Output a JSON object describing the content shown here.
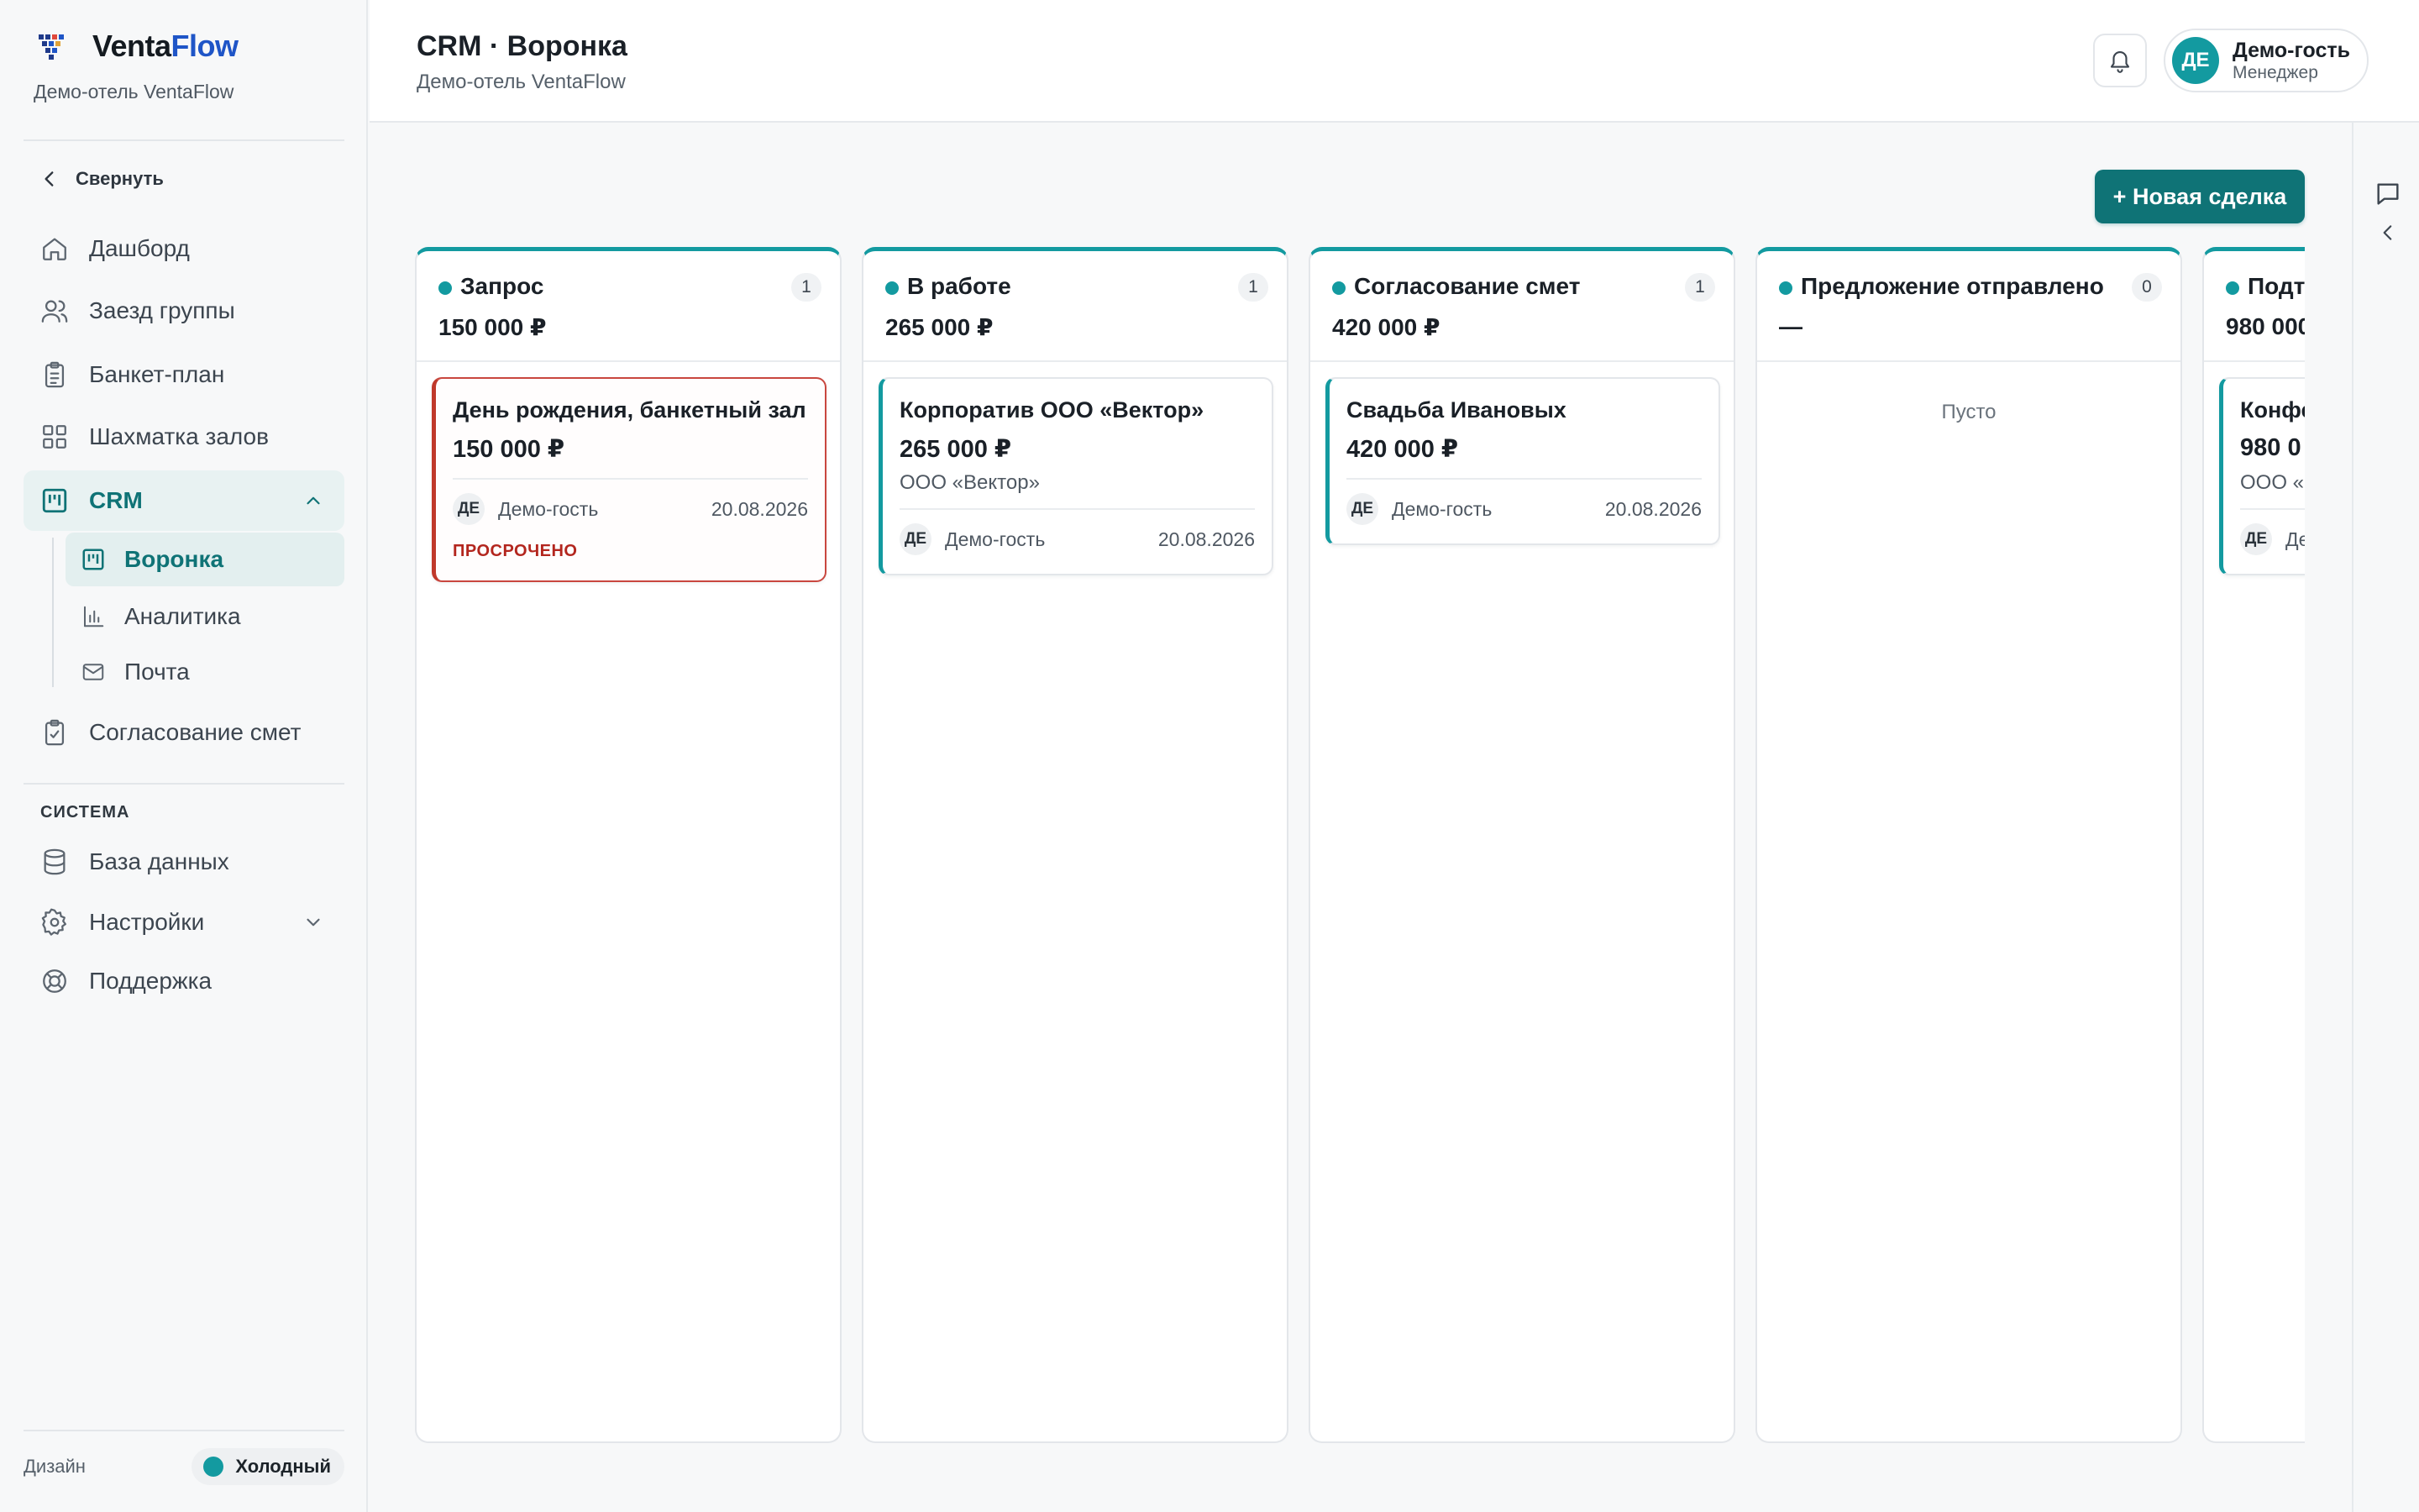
{
  "brand": {
    "name_part1": "Venta",
    "name_part2": "Flow",
    "subtitle": "Демо-отель VentaFlow"
  },
  "sidebar": {
    "collapse_label": "Свернуть",
    "items": [
      {
        "label": "Дашборд",
        "icon": "home-icon"
      },
      {
        "label": "Заезд группы",
        "icon": "users-icon"
      },
      {
        "label": "Банкет-план",
        "icon": "clipboard-icon"
      },
      {
        "label": "Шахматка залов",
        "icon": "grid-icon"
      },
      {
        "label": "CRM",
        "icon": "kanban-icon",
        "expanded": true
      },
      {
        "label": "Согласование смет",
        "icon": "clipboard-check-icon"
      }
    ],
    "crm_sub": [
      {
        "label": "Воронка",
        "icon": "kanban-icon",
        "active": true
      },
      {
        "label": "Аналитика",
        "icon": "bar-chart-icon"
      },
      {
        "label": "Почта",
        "icon": "mail-icon"
      }
    ],
    "system_label": "СИСТЕМА",
    "system_items": [
      {
        "label": "База данных",
        "icon": "database-icon"
      },
      {
        "label": "Настройки",
        "icon": "gear-icon"
      },
      {
        "label": "Поддержка",
        "icon": "lifebuoy-icon"
      }
    ],
    "footer": {
      "design_label": "Дизайн",
      "theme_label": "Холодный",
      "theme_color": "#139aa0"
    }
  },
  "header": {
    "title": "CRM · Воронка",
    "subtitle": "Демо-отель VentaFlow",
    "user": {
      "initials": "ДЕ",
      "name": "Демо-гость",
      "role": "Менеджер"
    }
  },
  "board": {
    "new_deal_label": "+ Новая сделка",
    "accent_color": "#139aa0",
    "columns": [
      {
        "title": "Запрос",
        "count": "1",
        "sum": "150 000 ₽",
        "cards": [
          {
            "title": "День рождения, банкетный зал",
            "amount": "150 000 ₽",
            "company": "",
            "owner_initials": "ДЕ",
            "owner": "Демо-гость",
            "date": "20.08.2026",
            "flag": "ПРОСРОЧЕНО"
          }
        ]
      },
      {
        "title": "В работе",
        "count": "1",
        "sum": "265 000 ₽",
        "cards": [
          {
            "title": "Корпоратив ООО «Вектор»",
            "amount": "265 000 ₽",
            "company": "ООО «Вектор»",
            "owner_initials": "ДЕ",
            "owner": "Демо-гость",
            "date": "20.08.2026",
            "flag": ""
          }
        ]
      },
      {
        "title": "Согласование смет",
        "count": "1",
        "sum": "420 000 ₽",
        "cards": [
          {
            "title": "Свадьба Ивановых",
            "amount": "420 000 ₽",
            "company": "",
            "owner_initials": "ДЕ",
            "owner": "Демо-гость",
            "date": "20.08.2026",
            "flag": ""
          }
        ]
      },
      {
        "title": "Предложение отправлено",
        "count": "0",
        "sum": "—",
        "empty_text": "Пусто",
        "cards": []
      },
      {
        "title": "Подт",
        "count": "",
        "sum": "980 000",
        "cards": [
          {
            "title": "Конфе",
            "amount": "980 0",
            "company": "ООО «",
            "owner_initials": "ДЕ",
            "owner": "Де",
            "date": "",
            "flag": ""
          }
        ]
      }
    ]
  }
}
